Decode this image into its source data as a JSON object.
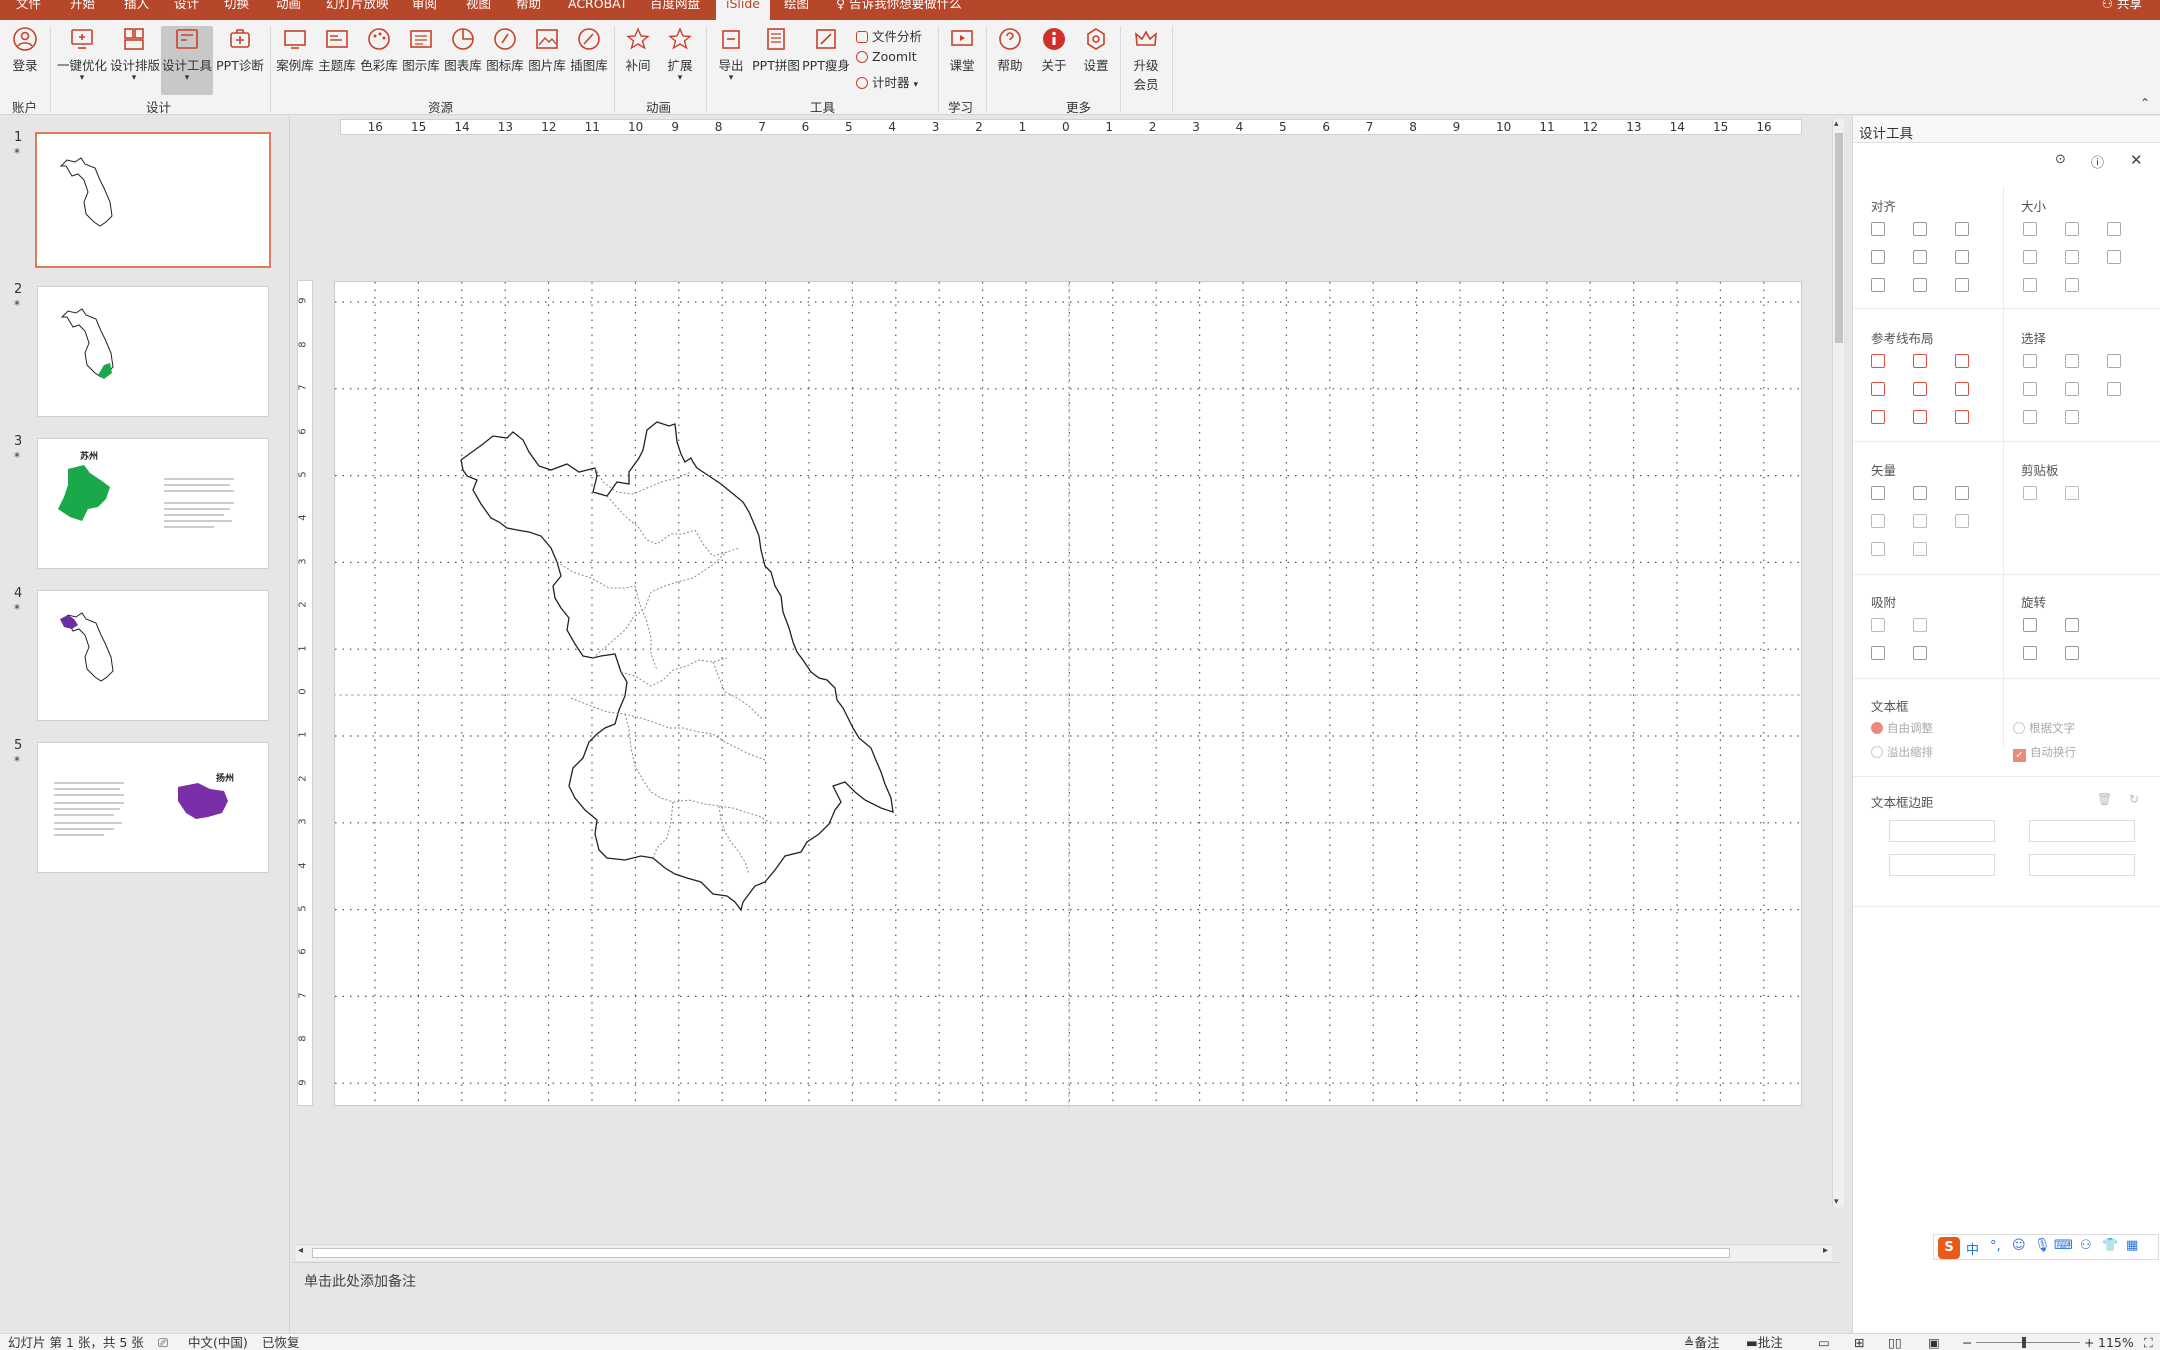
{
  "menubar": {
    "tabs": [
      "文件",
      "开始",
      "插入",
      "设计",
      "切换",
      "动画",
      "幻灯片放映",
      "审阅",
      "视图",
      "帮助",
      "ACROBAT",
      "百度网盘",
      "iSlide",
      "绘图"
    ],
    "active_tab": "iSlide",
    "tell_me": "告诉我你想要做什么",
    "share": "共享"
  },
  "ribbon": {
    "account": {
      "login": "登录",
      "group": "账户"
    },
    "design": {
      "one_click": "一键优化",
      "layout": "设计排版",
      "tools": "设计工具",
      "diagnose": "PPT诊断",
      "group": "设计"
    },
    "resources": {
      "cases": "案例库",
      "themes": "主题库",
      "colors": "色彩库",
      "diagrams": "图示库",
      "charts": "图表库",
      "icons": "图标库",
      "images": "图片库",
      "illustrations": "插图库",
      "group": "资源"
    },
    "animation": {
      "tween": "补间",
      "extend": "扩展",
      "group": "动画"
    },
    "tools": {
      "export": "导出",
      "collage": "PPT拼图",
      "slim": "PPT瘦身",
      "file_analysis": "文件分析",
      "zoomit": "ZoomIt",
      "timer": "计时器",
      "group": "工具"
    },
    "learn": {
      "classroom": "课堂",
      "group": "学习"
    },
    "more": {
      "help": "帮助",
      "about": "关于",
      "settings": "设置",
      "upgrade_line1": "升级",
      "upgrade_line2": "会员",
      "group": "更多"
    }
  },
  "thumbnails": [
    {
      "num": "1",
      "star": "*"
    },
    {
      "num": "2",
      "star": "*"
    },
    {
      "num": "3",
      "star": "*",
      "title": "苏州"
    },
    {
      "num": "4",
      "star": "*"
    },
    {
      "num": "5",
      "star": "*",
      "title": "扬州"
    }
  ],
  "ruler": {
    "h_labels": [
      "16",
      "15",
      "14",
      "13",
      "12",
      "11",
      "10",
      "9",
      "8",
      "7",
      "6",
      "5",
      "4",
      "3",
      "2",
      "1",
      "0",
      "1",
      "2",
      "3",
      "4",
      "5",
      "6",
      "7",
      "8",
      "9",
      "10",
      "11",
      "12",
      "13",
      "14",
      "15",
      "16"
    ],
    "v_labels": [
      "9",
      "8",
      "7",
      "6",
      "5",
      "4",
      "3",
      "2",
      "1",
      "0",
      "1",
      "2",
      "3",
      "4",
      "5",
      "6",
      "7",
      "8",
      "9"
    ]
  },
  "notes_placeholder": "单击此处添加备注",
  "panel": {
    "title": "设计工具",
    "align": "对齐",
    "size": "大小",
    "guide_layout": "参考线布局",
    "select": "选择",
    "vector": "矢量",
    "clipboard": "剪贴板",
    "snap": "吸附",
    "rotate": "旋转",
    "textbox": "文本框",
    "auto_adjust": "自由调整",
    "fit_text": "根据文字",
    "overflow_shrink": "溢出缩排",
    "auto_wrap": "自动换行",
    "textbox_margin": "文本框边距"
  },
  "statusbar": {
    "slide_info": "幻灯片 第 1 张，共 5 张",
    "language": "中文(中国)",
    "recovered": "已恢复",
    "notes": "备注",
    "comments": "批注",
    "zoom": "115%"
  },
  "colors": {
    "accent": "#b7472a",
    "suzhou": "#1aa84a",
    "xuzhou": "#6a2fa0",
    "yangzhou": "#7a2fa8"
  }
}
